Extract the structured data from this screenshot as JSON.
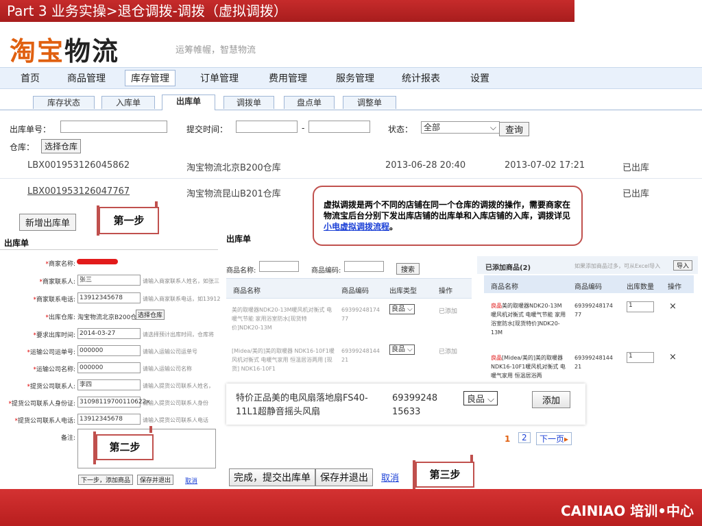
{
  "slide_title": "Part  3   业务实操>退仓调拨-调拨（虚拟调拨）",
  "logo": {
    "text1": "淘宝",
    "text2": "物流",
    "slogan": "运筹帷幄，智慧物流"
  },
  "main_nav": [
    "首页",
    "商品管理",
    "库存管理",
    "订单管理",
    "费用管理",
    "服务管理",
    "统计报表",
    "设置"
  ],
  "sub_tabs": [
    "库存状态",
    "入库单",
    "出库单",
    "调拨单",
    "盘点单",
    "调整单"
  ],
  "filters": {
    "order_no_label": "出库单号：",
    "submit_time_label": "提交时间：",
    "dash": "-",
    "status_label": "状态：",
    "status_value": "全部",
    "query_button": "查询",
    "warehouse_label": "仓库：",
    "warehouse_button": "选择仓库"
  },
  "rows": [
    {
      "id": "LBX001953126045862",
      "warehouse": "淘宝物流北京B200仓库",
      "t1": "2013-06-28 20:40",
      "t2": "2013-07-02 17:21",
      "status": "已出库"
    },
    {
      "id": "LBX001953126047767",
      "warehouse": "淘宝物流昆山B201仓库",
      "t1": "",
      "t2": "",
      "status": "已出库"
    }
  ],
  "add_button": "新增出库单",
  "steps": {
    "s1": "第一步",
    "s2": "第二步",
    "s3": "第三步"
  },
  "info": {
    "text": "虚拟调拨是两个不同的店铺在同一个仓库的调拨的操作，需要商家在物流宝后台分别下发出库店铺的出库单和入库店铺的入库，调拨详见",
    "link": "小电虚拟调拨流程",
    "end": "。"
  },
  "left_form": {
    "title": "出库单",
    "fields": [
      {
        "label": "商家名称:",
        "value": "",
        "hint": ""
      },
      {
        "label": "商家联系人:",
        "value": "张三",
        "hint": "请输入商家联系人姓名，如张三"
      },
      {
        "label": "商家联系电话:",
        "value": "13912345678",
        "hint": "请输入商家联系电话，如13912"
      },
      {
        "label": "出库仓库:",
        "value": "淘宝物流北京B200仓库",
        "hint": ""
      },
      {
        "label": "要求出库时间:",
        "value": "2014-03-27",
        "hint": "请选择预计出库时间，仓库将"
      },
      {
        "label": "运输公司运单号:",
        "value": "000000",
        "hint": "请输入运输公司运单号"
      },
      {
        "label": "运输公司名称:",
        "value": "000000",
        "hint": "请输入运输公司名称"
      },
      {
        "label": "提货公司联系人:",
        "value": "李四",
        "hint": "请输入提货公司联系人姓名，"
      },
      {
        "label": "提货公司联系人身份证:",
        "value": "31098119700110622x",
        "hint": "请输入提货公司联系人身份"
      },
      {
        "label": "提货公司联系人电话:",
        "value": "13912345678",
        "hint": "请输入提货公司联系人电话"
      }
    ],
    "choose_wh_btn": "选择仓库",
    "remark_label": "备注:",
    "next_btn": "下一步，添加商品",
    "save_btn": "保存并退出",
    "cancel_link": "取消"
  },
  "mid": {
    "title": "出库单",
    "name_label": "商品名称:",
    "code_label": "商品编码:",
    "search_btn": "搜索",
    "headers": [
      "商品名称",
      "商品编码",
      "出库类型",
      "操作"
    ],
    "items": [
      {
        "name": "美的取暖器NDK20-13M暖风机对衡式 电暖气节能 家用浴室防水[现货特价]NDK20-13M",
        "code": "6939924817477",
        "type": "良品",
        "op": "已添加"
      },
      {
        "name": "[Midea/美的]美的取暖器 NDK16-10F1暖风机对衡式 电暖气家用 恒温居浴两用 [现货] NDK16-10F1",
        "code": "6939924814421",
        "type": "良品",
        "op": "已添加"
      }
    ],
    "zoom": {
      "name": "特价正品美的电风扇落地扇FS40-11L1超静音摇头风扇",
      "code": "6939924815633",
      "type": "良品",
      "btn": "添加"
    },
    "finish_btn": "完成，提交出库单",
    "save_btn": "保存并退出",
    "cancel_link": "取消"
  },
  "right": {
    "title": "已添加商品(2)",
    "hint": "如果添加商品过多，可从Excel导入",
    "import_btn": "导入",
    "headers": [
      "商品名称",
      "商品编码",
      "出库数量",
      "操作"
    ],
    "items": [
      {
        "tag": "良品",
        "name": "美的取暖器NDK20-13M暖风机对衡式 电暖气节能 家用浴室防水[现货特价]NDK20-13M",
        "code": "6939924817477",
        "qty": "1",
        "op": "×"
      },
      {
        "tag": "良品",
        "name": "[Midea/美的]美的取暖器 NDK16-10F1暖风机对衡式 电暖气家用 恒温居浴两",
        "code": "6939924814421",
        "qty": "1",
        "op": "×"
      }
    ],
    "pages": [
      "1",
      "2"
    ],
    "next_page": "下一页"
  },
  "footer": {
    "brand": "CAINIAO  培训•中心"
  },
  "colors": {
    "red": "#c0504d",
    "title_red": "#b81e1e",
    "link_blue": "#1a3fd6"
  }
}
